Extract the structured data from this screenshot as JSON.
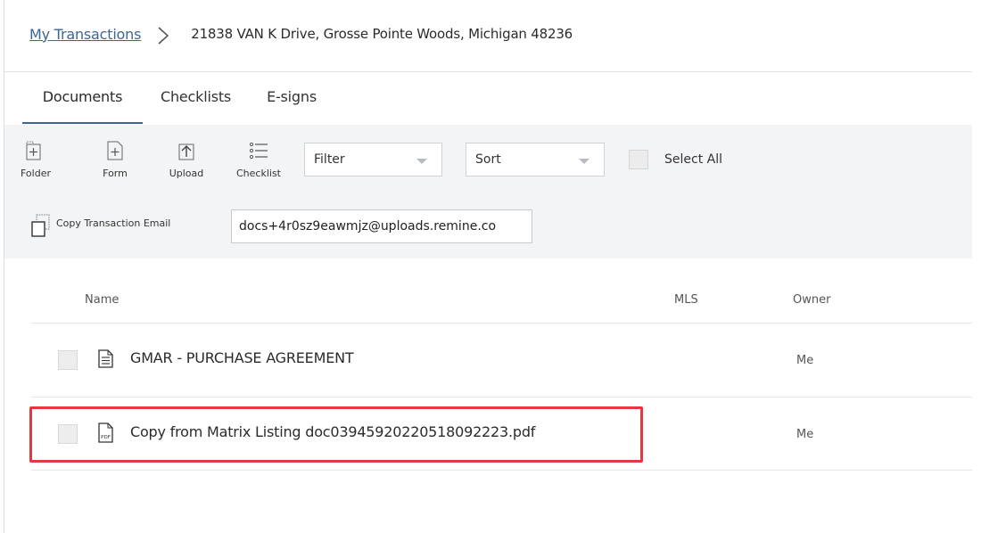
{
  "breadcrumb": {
    "link": "My Transactions",
    "current": "21838 VAN K Drive, Grosse Pointe Woods, Michigan 48236"
  },
  "tabs": [
    {
      "label": "Documents",
      "active": true
    },
    {
      "label": "Checklists",
      "active": false
    },
    {
      "label": "E-signs",
      "active": false
    }
  ],
  "toolbar": {
    "folder_label": "Folder",
    "form_label": "Form",
    "upload_label": "Upload",
    "checklist_label": "Checklist",
    "filter": {
      "selected": "Filter"
    },
    "sort": {
      "selected": "Sort"
    },
    "select_all_label": "Select All",
    "copy_email_label": "Copy Transaction Email",
    "email_value": "docs+4r0sz9eawmjz@uploads.remine.co"
  },
  "table": {
    "columns": [
      "Name",
      "MLS",
      "Owner"
    ],
    "rows": [
      {
        "name": "GMAR - PURCHASE AGREEMENT",
        "mls": "",
        "owner": "Me",
        "icon": "document-icon"
      },
      {
        "name": "Copy from Matrix Listing doc03945920220518092223.pdf",
        "mls": "",
        "owner": "Me",
        "icon": "pdf-icon"
      }
    ]
  },
  "colors": {
    "accent": "#3f6497",
    "toolbar_bg": "#f3f4f6",
    "highlight": "#e0393e"
  }
}
